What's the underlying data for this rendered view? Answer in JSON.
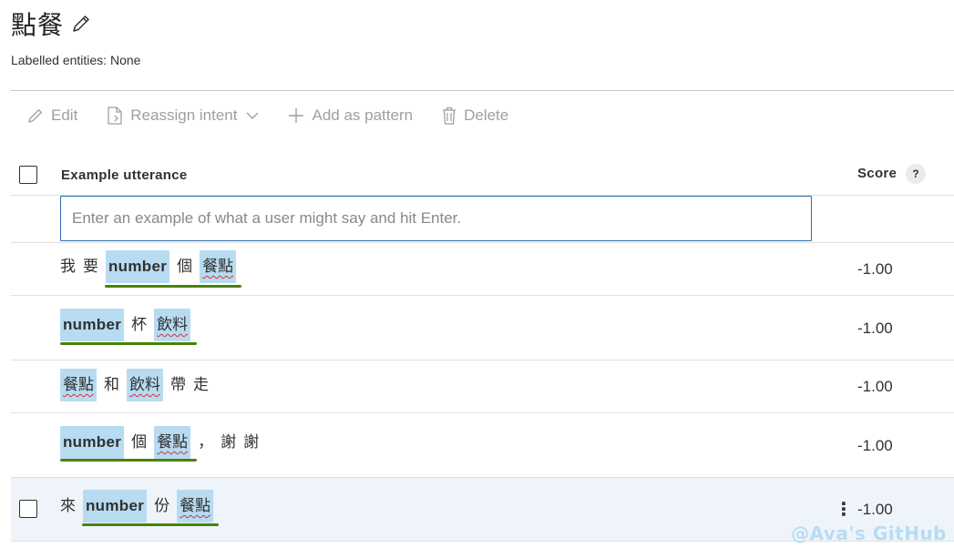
{
  "header": {
    "title": "點餐",
    "subtitle": "Labelled entities: None"
  },
  "toolbar": {
    "edit_label": "Edit",
    "reassign_label": "Reassign intent",
    "add_pattern_label": "Add as pattern",
    "delete_label": "Delete"
  },
  "table": {
    "col_utterance": "Example utterance",
    "col_score": "Score",
    "help": "?"
  },
  "input": {
    "placeholder": "Enter an example of what a user might say and hit Enter.",
    "value": ""
  },
  "rows": [
    {
      "tokens": [
        "我",
        "要",
        "number",
        "個",
        "餐點"
      ],
      "score": "-1.00"
    },
    {
      "tokens": [
        "number",
        "杯",
        "飲料"
      ],
      "score": "-1.00"
    },
    {
      "tokens": [
        "餐點",
        "和",
        "飲料",
        "帶",
        "走"
      ],
      "score": "-1.00"
    },
    {
      "tokens": [
        "number",
        "個",
        "餐點",
        "，",
        "謝",
        "謝"
      ],
      "score": "-1.00"
    },
    {
      "tokens": [
        "來",
        "number",
        "份",
        "餐點"
      ],
      "score": "-1.00",
      "selected": true
    }
  ],
  "row_menu": "⋮",
  "watermark": "@Ava's GitHub",
  "colors": {
    "entity_chip": "#b7dbf1",
    "entity_underline": "#498205",
    "input_border": "#2b6cb0",
    "selected_row": "#eff4fb"
  }
}
